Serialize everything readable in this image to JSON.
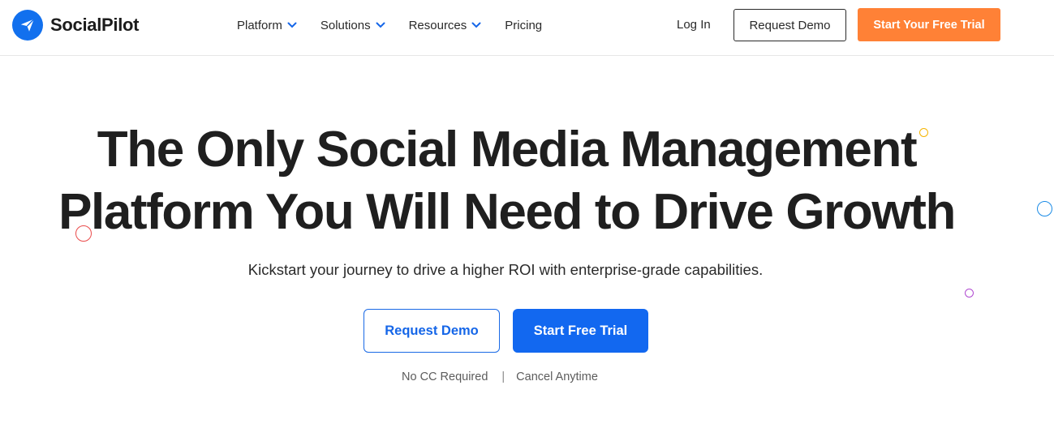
{
  "header": {
    "brand": "SocialPilot",
    "nav": [
      {
        "label": "Platform",
        "has_dropdown": true
      },
      {
        "label": "Solutions",
        "has_dropdown": true
      },
      {
        "label": "Resources",
        "has_dropdown": true
      },
      {
        "label": "Pricing",
        "has_dropdown": false
      }
    ],
    "login_label": "Log In",
    "request_demo_label": "Request Demo",
    "free_trial_label": "Start Your Free Trial"
  },
  "hero": {
    "title_line1": "The Only Social Media Management",
    "title_line2": "Platform You Will Need to Drive Growth",
    "subtitle": "Kickstart your journey to drive a higher ROI with enterprise-grade capabilities.",
    "request_demo_label": "Request Demo",
    "free_trial_label": "Start Free Trial",
    "note_left": "No CC Required",
    "note_separator": "|",
    "note_right": "Cancel Anytime"
  },
  "colors": {
    "brand_blue": "#1270ee",
    "cta_orange": "#ff8136",
    "cta_blue": "#1268f0"
  },
  "icons": {
    "logo": "paper-plane-icon",
    "dropdown": "chevron-down-icon"
  }
}
